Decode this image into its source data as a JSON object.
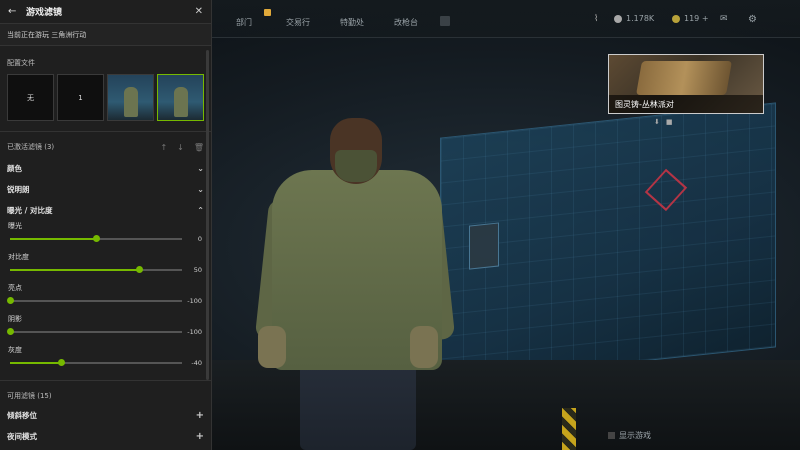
{
  "panel": {
    "back_icon": "arrow-left-icon",
    "title": "游戏滤镜",
    "close_icon": "close-icon",
    "current_game": "当前正在游玩 三角洲行动"
  },
  "profiles": {
    "label": "配置文件",
    "items": [
      {
        "label": "无",
        "type": "text"
      },
      {
        "label": "1",
        "type": "text"
      },
      {
        "label": "",
        "type": "image"
      },
      {
        "label": "",
        "type": "image",
        "active": true
      }
    ]
  },
  "active_filters": {
    "label": "已激活滤镜 (3)",
    "icons": [
      "arrow-up-icon",
      "arrow-down-icon",
      "trash-icon"
    ],
    "items": [
      {
        "name": "颜色",
        "expanded": false
      },
      {
        "name": "锐明朗",
        "expanded": false
      },
      {
        "name": "曝光 / 对比度",
        "expanded": true
      }
    ],
    "sliders": [
      {
        "label": "曝光",
        "value": "0",
        "position": 0.5
      },
      {
        "label": "对比度",
        "value": "50",
        "position": 0.75
      },
      {
        "label": "亮点",
        "value": "-100",
        "position": 0.0
      },
      {
        "label": "阴影",
        "value": "-100",
        "position": 0.0
      },
      {
        "label": "灰度",
        "value": "-40",
        "position": 0.3
      }
    ]
  },
  "available_filters": {
    "label": "可用滤镜 (15)",
    "items": [
      {
        "name": "倾斜移位"
      },
      {
        "name": "夜间模式"
      }
    ]
  },
  "topbar": {
    "nav": [
      "部门",
      "交易行",
      "特勤处",
      "改枪台"
    ],
    "currency_1": "1.178K",
    "currency_2": "119 +",
    "colors": {
      "accent": "#76b900",
      "badge": "#e0a93a"
    }
  },
  "event_card": {
    "title": "图灵铸-丛林派对"
  },
  "show_ui": "显示游戏"
}
